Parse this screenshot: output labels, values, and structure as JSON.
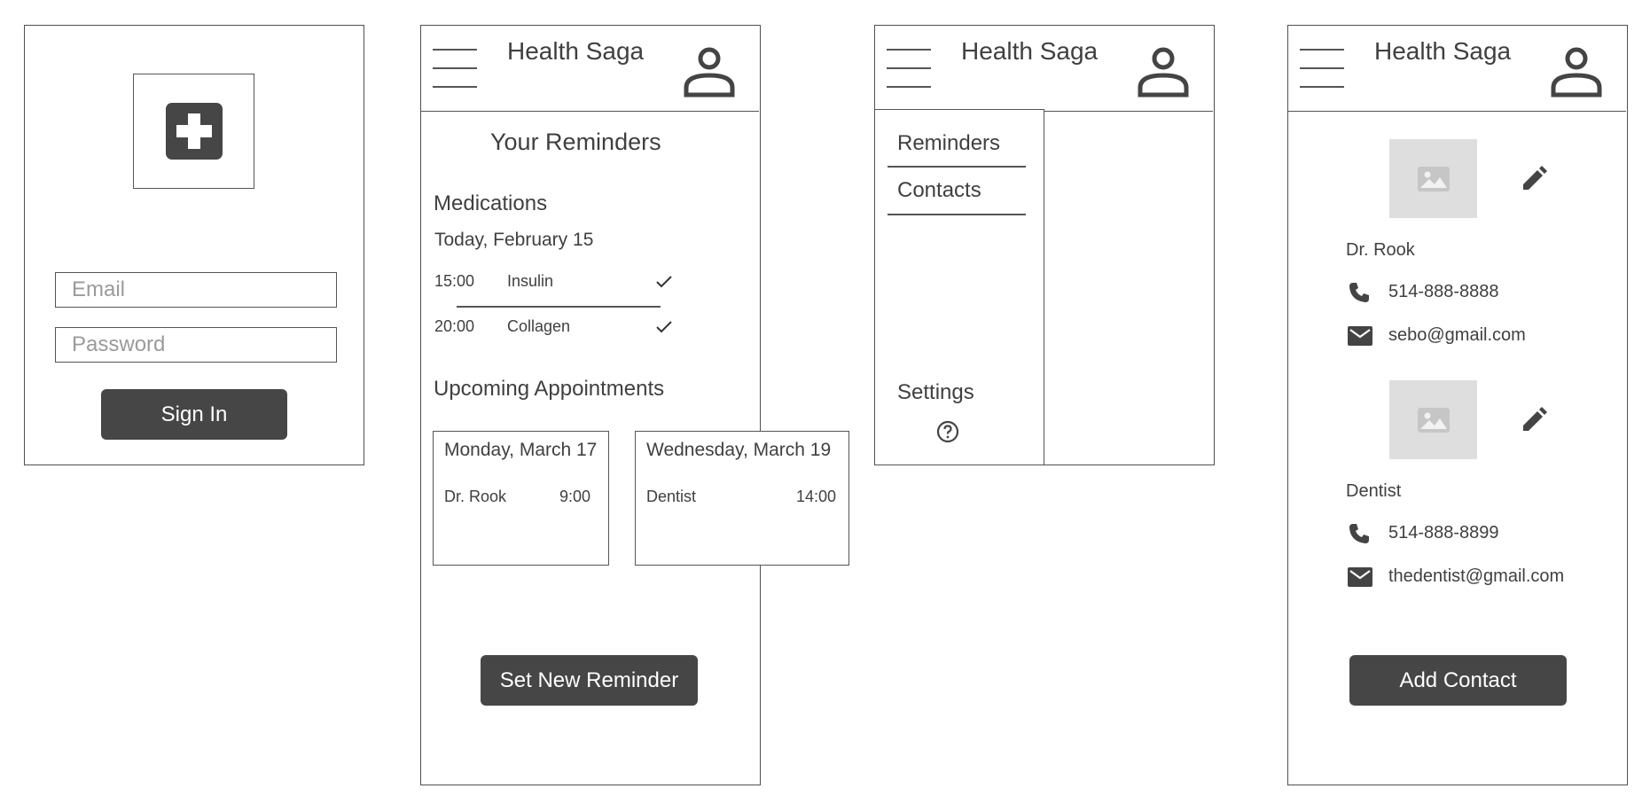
{
  "login": {
    "logo_icon": "medical-cross-icon",
    "email_placeholder": "Email",
    "password_placeholder": "Password",
    "sign_in_label": "Sign In"
  },
  "header": {
    "title": "Health Saga",
    "menu_icon": "hamburger-menu-icon",
    "profile_icon": "user-profile-icon"
  },
  "reminders": {
    "page_title": "Your Reminders",
    "medications_heading": "Medications",
    "date_label": "Today, February 15",
    "medications": [
      {
        "time": "15:00",
        "name": "Insulin",
        "status_icon": "checkmark-icon"
      },
      {
        "time": "20:00",
        "name": "Collagen",
        "status_icon": "checkmark-icon"
      }
    ],
    "appointments_heading": "Upcoming Appointments",
    "appointments": [
      {
        "date": "Monday, March 17",
        "who": "Dr. Rook",
        "time": "9:00"
      },
      {
        "date": "Wednesday, March 19",
        "who": "Dentist",
        "time": "14:00"
      }
    ],
    "new_reminder_label": "Set New Reminder"
  },
  "menu": {
    "items": [
      {
        "label": "Reminders"
      },
      {
        "label": "Contacts"
      }
    ],
    "settings_label": "Settings",
    "help_icon": "help-circle-icon"
  },
  "contacts": {
    "list": [
      {
        "name": "Dr. Rook",
        "phone": "514-888-8888",
        "email": "sebo@gmail.com"
      },
      {
        "name": "Dentist",
        "phone": "514-888-8899",
        "email": "thedentist@gmail.com"
      }
    ],
    "add_label": "Add Contact"
  },
  "colors": {
    "dark": "#464646",
    "border": "#555555",
    "placeholder_image": "#dedede"
  }
}
